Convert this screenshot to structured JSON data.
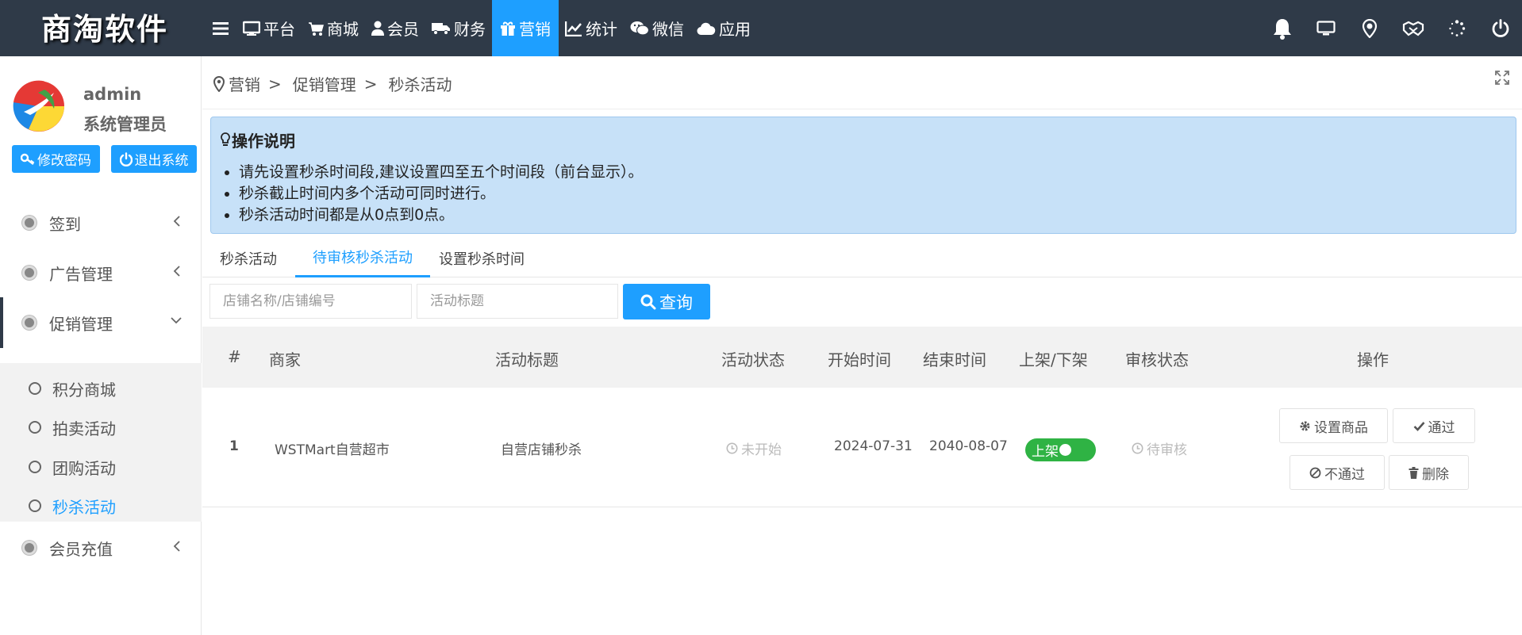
{
  "brand": "商淘软件",
  "nav": {
    "menu_icon": "hamburger-icon",
    "items": [
      {
        "label": "平台",
        "icon": "monitor-icon"
      },
      {
        "label": "商城",
        "icon": "cart-icon"
      },
      {
        "label": "会员",
        "icon": "user-icon"
      },
      {
        "label": "财务",
        "icon": "truck-icon"
      },
      {
        "label": "营销",
        "icon": "gift-icon",
        "active": true
      },
      {
        "label": "统计",
        "icon": "chart-line-icon"
      },
      {
        "label": "微信",
        "icon": "wechat-icon"
      },
      {
        "label": "应用",
        "icon": "cloud-icon"
      }
    ],
    "right_icons": [
      "bell-icon",
      "desktop-icon",
      "location-icon",
      "handshake-icon",
      "spinner-icon",
      "power-icon"
    ]
  },
  "user": {
    "name": "admin",
    "role": "系统管理员",
    "change_password": "修改密码",
    "logout": "退出系统"
  },
  "sidebar": {
    "groups": [
      {
        "label": "签到"
      },
      {
        "label": "广告管理"
      },
      {
        "label": "促销管理",
        "open": true
      },
      {
        "label": "会员充值"
      }
    ],
    "sub_items": [
      {
        "label": "积分商城"
      },
      {
        "label": "拍卖活动"
      },
      {
        "label": "团购活动"
      },
      {
        "label": "秒杀活动",
        "active": true
      }
    ]
  },
  "breadcrumb": [
    "营销",
    "促销管理",
    "秒杀活动"
  ],
  "breadcrumb_sep": ">",
  "tips": {
    "title": "操作说明",
    "items": [
      "请先设置秒杀时间段,建议设置四至五个时间段（前台显示）。",
      "秒杀截止时间内多个活动可同时进行。",
      "秒杀活动时间都是从0点到0点。"
    ]
  },
  "tabs": [
    "秒杀活动",
    "待审核秒杀活动",
    "设置秒杀时间"
  ],
  "active_tab": 1,
  "search": {
    "shop_placeholder": "店铺名称/店铺编号",
    "title_placeholder": "活动标题",
    "button": "查询"
  },
  "table": {
    "headers": [
      "#",
      "商家",
      "活动标题",
      "活动状态",
      "开始时间",
      "结束时间",
      "上架/下架",
      "审核状态",
      "操作"
    ],
    "rows": [
      {
        "index": "1",
        "shop": "WSTMart自营超市",
        "title": "自营店铺秒杀",
        "status": "未开始",
        "start": "2024-07-31",
        "end": "2040-08-07",
        "shelf": "上架",
        "audit": "待审核"
      }
    ],
    "actions": {
      "set_goods": "设置商品",
      "approve": "通过",
      "reject": "不通过",
      "delete": "删除"
    }
  },
  "colors": {
    "topbar": "#2f3a48",
    "accent": "#1e9fff",
    "tips_bg": "#c7e1f8",
    "toggle_on": "#2fb344"
  }
}
